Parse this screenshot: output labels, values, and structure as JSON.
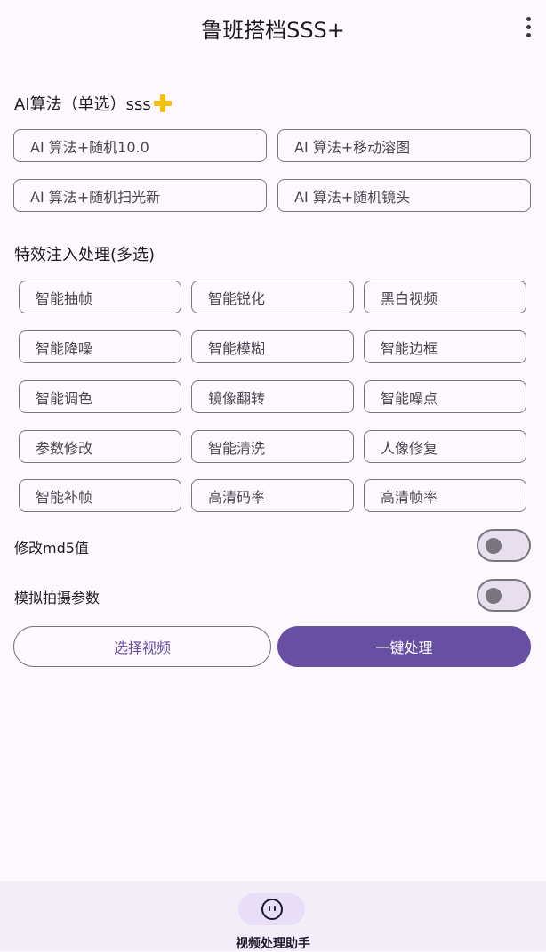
{
  "app": {
    "title": "鲁班搭档SSS+"
  },
  "algorithm_section": {
    "title": "AI算法（单选）sss",
    "options": [
      "AI 算法+随机10.0",
      "AI 算法+移动溶图",
      "AI 算法+随机扫光新",
      "AI 算法+随机镜头"
    ]
  },
  "effects_section": {
    "title": "特效注入处理(多选)",
    "options": [
      "智能抽帧",
      "智能锐化",
      "黑白视频",
      "智能降噪",
      "智能模糊",
      "智能边框",
      "智能调色",
      "镜像翻转",
      "智能噪点",
      "参数修改",
      "智能清洗",
      "人像修复",
      "智能补帧",
      "高清码率",
      "高清帧率"
    ]
  },
  "toggles": [
    {
      "label": "修改md5值",
      "on": false
    },
    {
      "label": "模拟拍摄参数",
      "on": false
    }
  ],
  "actions": {
    "select_video": "选择视频",
    "process": "一键处理"
  },
  "bottom_nav": {
    "label": "视频处理助手",
    "icon": "face-icon"
  },
  "colors": {
    "primary": "#6750a4",
    "background": "#fdf8fd",
    "nav_background": "#f3edf7",
    "nav_indicator": "#e8def8",
    "accent_plus": "#f4c20d"
  }
}
